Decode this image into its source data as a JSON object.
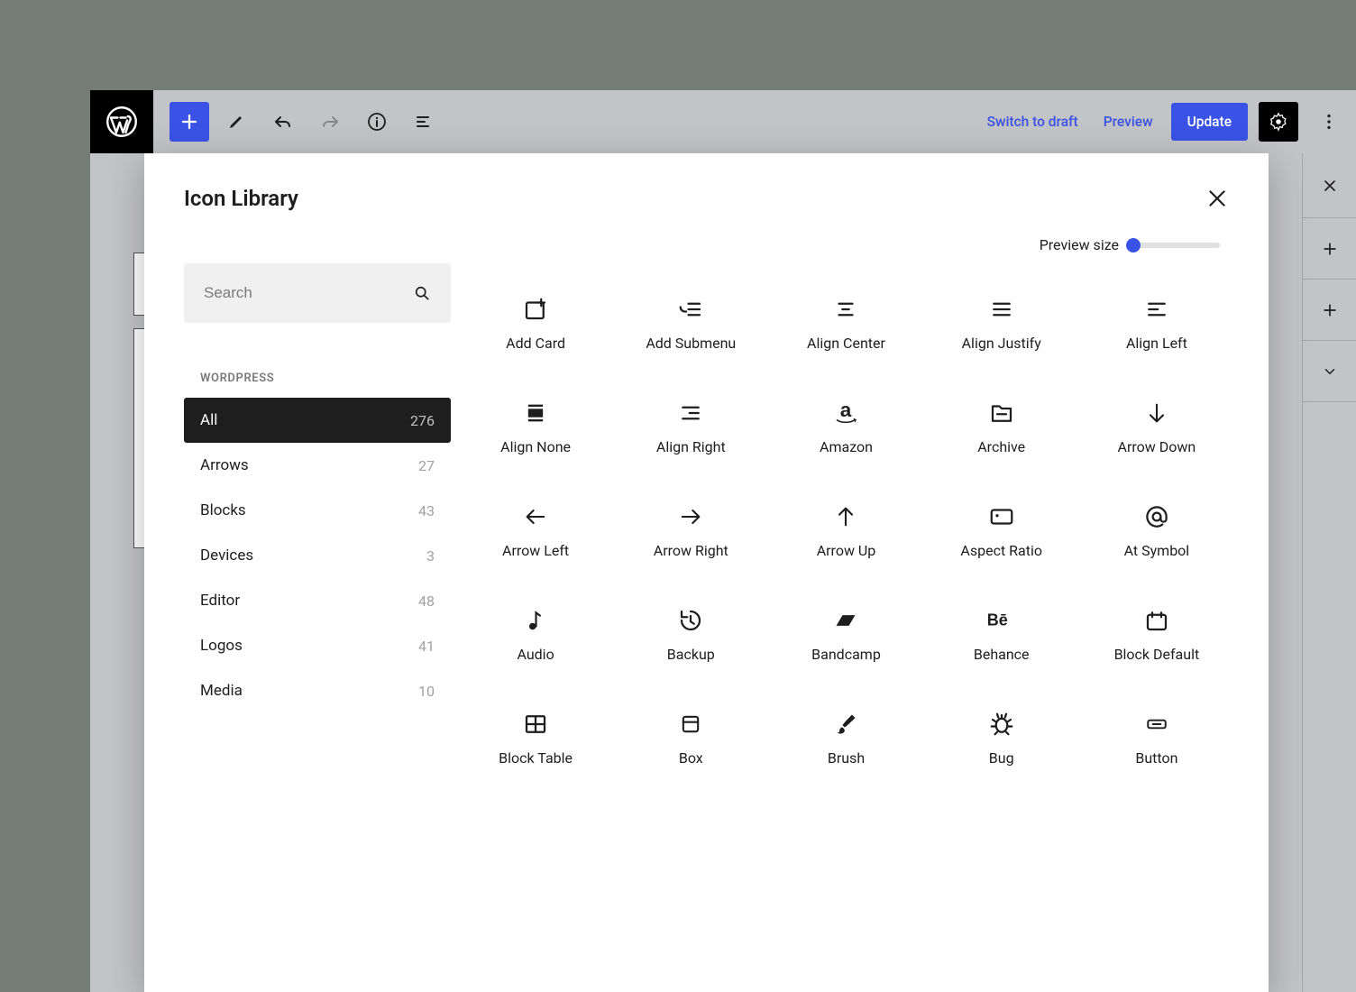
{
  "toolbar": {
    "switch_draft": "Switch to draft",
    "preview": "Preview",
    "update": "Update"
  },
  "modal": {
    "title": "Icon Library",
    "search_placeholder": "Search",
    "preview_size_label": "Preview size",
    "section_label": "WORDPRESS"
  },
  "categories": [
    {
      "label": "All",
      "count": "276",
      "active": true
    },
    {
      "label": "Arrows",
      "count": "27",
      "active": false
    },
    {
      "label": "Blocks",
      "count": "43",
      "active": false
    },
    {
      "label": "Devices",
      "count": "3",
      "active": false
    },
    {
      "label": "Editor",
      "count": "48",
      "active": false
    },
    {
      "label": "Logos",
      "count": "41",
      "active": false
    },
    {
      "label": "Media",
      "count": "10",
      "active": false
    }
  ],
  "icons": [
    {
      "name": "Add Card",
      "id": "add-card"
    },
    {
      "name": "Add Submenu",
      "id": "add-submenu"
    },
    {
      "name": "Align Center",
      "id": "align-center"
    },
    {
      "name": "Align Justify",
      "id": "align-justify"
    },
    {
      "name": "Align Left",
      "id": "align-left"
    },
    {
      "name": "Align None",
      "id": "align-none"
    },
    {
      "name": "Align Right",
      "id": "align-right"
    },
    {
      "name": "Amazon",
      "id": "amazon"
    },
    {
      "name": "Archive",
      "id": "archive"
    },
    {
      "name": "Arrow Down",
      "id": "arrow-down"
    },
    {
      "name": "Arrow Left",
      "id": "arrow-left"
    },
    {
      "name": "Arrow Right",
      "id": "arrow-right"
    },
    {
      "name": "Arrow Up",
      "id": "arrow-up"
    },
    {
      "name": "Aspect Ratio",
      "id": "aspect-ratio"
    },
    {
      "name": "At Symbol",
      "id": "at-symbol"
    },
    {
      "name": "Audio",
      "id": "audio"
    },
    {
      "name": "Backup",
      "id": "backup"
    },
    {
      "name": "Bandcamp",
      "id": "bandcamp"
    },
    {
      "name": "Behance",
      "id": "behance"
    },
    {
      "name": "Block Default",
      "id": "block-default"
    },
    {
      "name": "Block Table",
      "id": "block-table"
    },
    {
      "name": "Box",
      "id": "box"
    },
    {
      "name": "Brush",
      "id": "brush"
    },
    {
      "name": "Bug",
      "id": "bug"
    },
    {
      "name": "Button",
      "id": "button"
    }
  ]
}
